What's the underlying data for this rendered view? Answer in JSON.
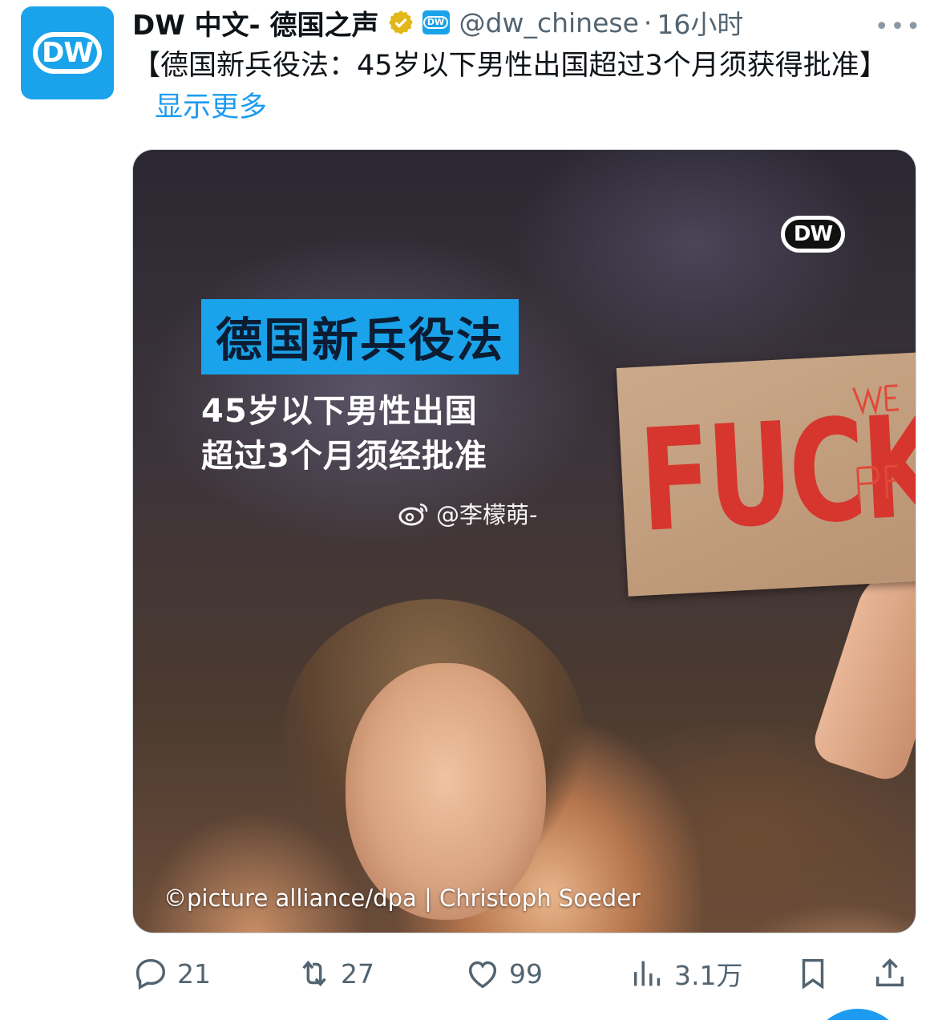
{
  "author": {
    "display_name": "DW 中文- 德国之声",
    "handle": "@dw_chinese",
    "separator": "·",
    "time": "16小时",
    "avatar_text": "DW",
    "badge_text": "DW",
    "verified_icon": "verified-gold-badge",
    "more_label": "•••"
  },
  "tweet": {
    "text": "【德国新兵役法：45岁以下男性出国超过3个月须获得批准】",
    "show_more": "显示更多"
  },
  "media": {
    "logo_text": "DW",
    "headline": "德国新兵役法",
    "subline_1": "45岁以下男性出国",
    "subline_2": "超过3个月须经批准",
    "watermark": "@李檬萌-",
    "sign_text": "FUCK",
    "credit": "©picture alliance/dpa | Christoph Soeder"
  },
  "actions": {
    "reply_count": "21",
    "retweet_count": "27",
    "like_count": "99",
    "views_count": "3.1万"
  },
  "colors": {
    "accent": "#1d9bf0",
    "dw_blue": "#1aa3ea",
    "secondary_text": "#536471",
    "verified_gold": "#e2b719"
  }
}
